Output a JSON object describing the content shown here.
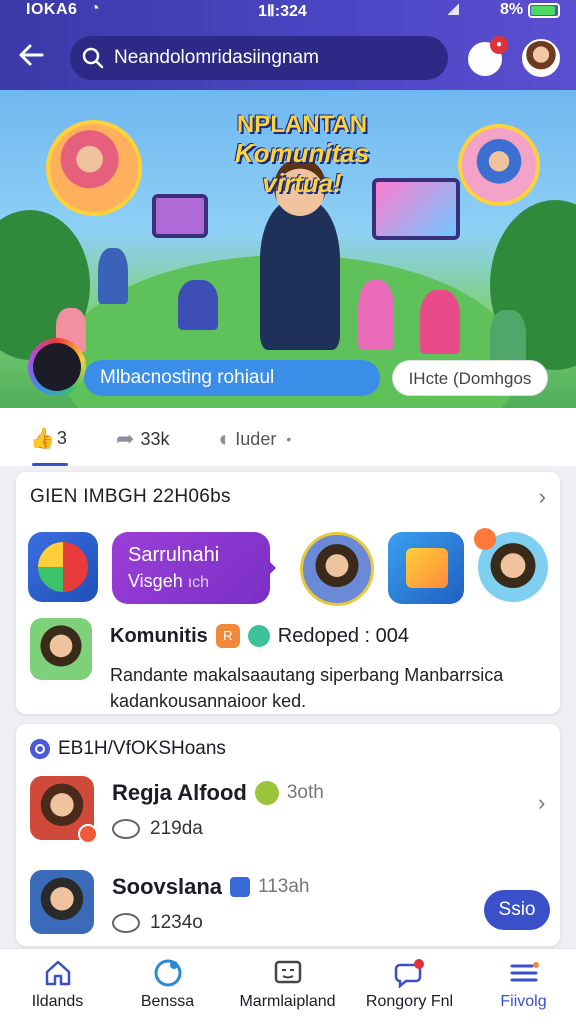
{
  "status": {
    "left": "IOKA6",
    "time": "1Ⅱ:324",
    "battery": "8%"
  },
  "search": {
    "text": "Neandolomridasiingnam"
  },
  "banner": {
    "title_line1": "NPLANTAN",
    "title_line2": "Komunitas virtua!",
    "pill_text": "Mlbacnosting rohiaul",
    "button_label": "IHcte (Domhgos"
  },
  "reactions": {
    "likes": "3",
    "shares": "33k",
    "comment_label": "Iuder",
    "more": "•"
  },
  "card1": {
    "header": "GIEN IMBGH 22H06bs",
    "chevron": "›",
    "promo_line1": "Sarrulnahi",
    "promo_line2": "Visgeh",
    "promo_line2_dim": "ıch",
    "post_title": "Komunitis",
    "post_badge": "R",
    "post_meta": "Redoped : 004",
    "post_body": "Randante makalsaautang siperbang Manbarrsica kadankousannaioor ked."
  },
  "card2": {
    "header": "EB1H/VfOKSHoans",
    "members": [
      {
        "name": "Regja Alfood",
        "time": "3oth",
        "count": "219da"
      },
      {
        "name": "Soovslana",
        "time": "113ah",
        "count": "1234o"
      }
    ],
    "chevron": "›",
    "fab_label": "Ssio"
  },
  "nav": {
    "items": [
      {
        "label": "Ildands"
      },
      {
        "label": "Benssa"
      },
      {
        "label": "Marmlaipland"
      },
      {
        "label": "Rongory Fnl"
      },
      {
        "label": "Fiivolg"
      }
    ]
  }
}
